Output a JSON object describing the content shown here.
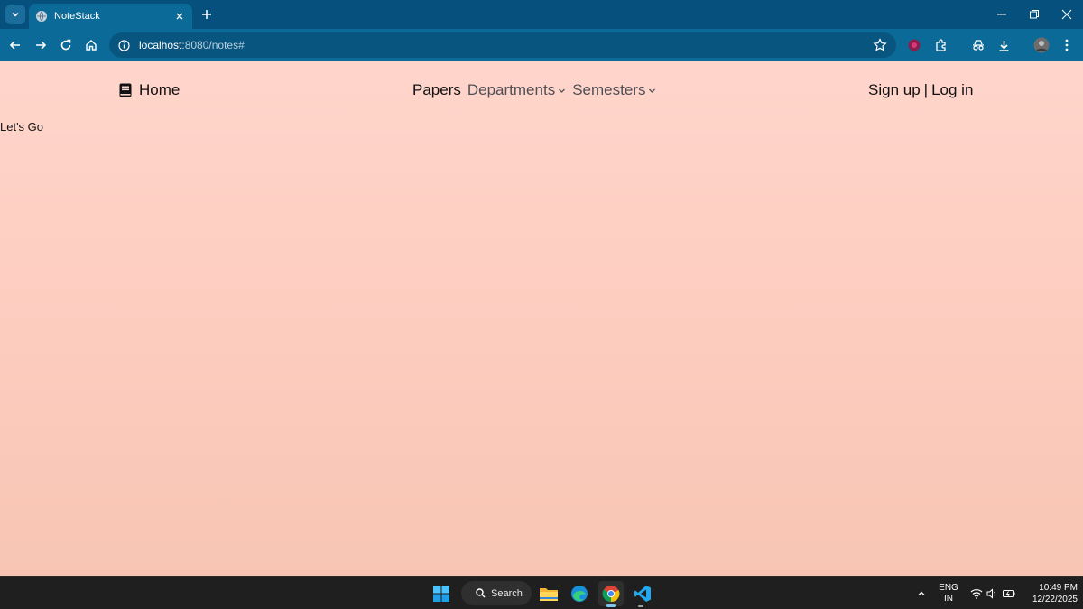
{
  "browser": {
    "tab_title": "NoteStack",
    "url_host": "localhost",
    "url_path": ":8080/notes#",
    "icons": [
      "tab-search-icon",
      "favicon-icon",
      "close-icon",
      "plus-icon",
      "minimize-icon",
      "restore-icon",
      "window-close-icon",
      "back-icon",
      "forward-icon",
      "reload-icon",
      "home-icon",
      "site-info-icon",
      "star-icon",
      "extension-icon",
      "puzzle-icon",
      "incognito-icon",
      "download-icon",
      "profile-avatar",
      "menu-kebab-icon"
    ]
  },
  "navbar": {
    "home_label": "Home",
    "papers_label": "Papers",
    "departments_label": "Departments",
    "semesters_label": "Semesters",
    "signup_label": "Sign up",
    "separator": "|",
    "login_label": "Log in"
  },
  "main": {
    "body_text": "Let's Go"
  },
  "taskbar": {
    "search_label": "Search",
    "lang_line1": "ENG",
    "lang_line2": "IN",
    "time": "10:49 PM",
    "date": "12/22/2025"
  },
  "colors": {
    "titlebar": "#06507e",
    "toolbar": "#0b6a98",
    "page_bg_top": "#ffd5cb",
    "page_bg_bottom": "#f8c5b3",
    "taskbar": "#1f1f1f"
  }
}
